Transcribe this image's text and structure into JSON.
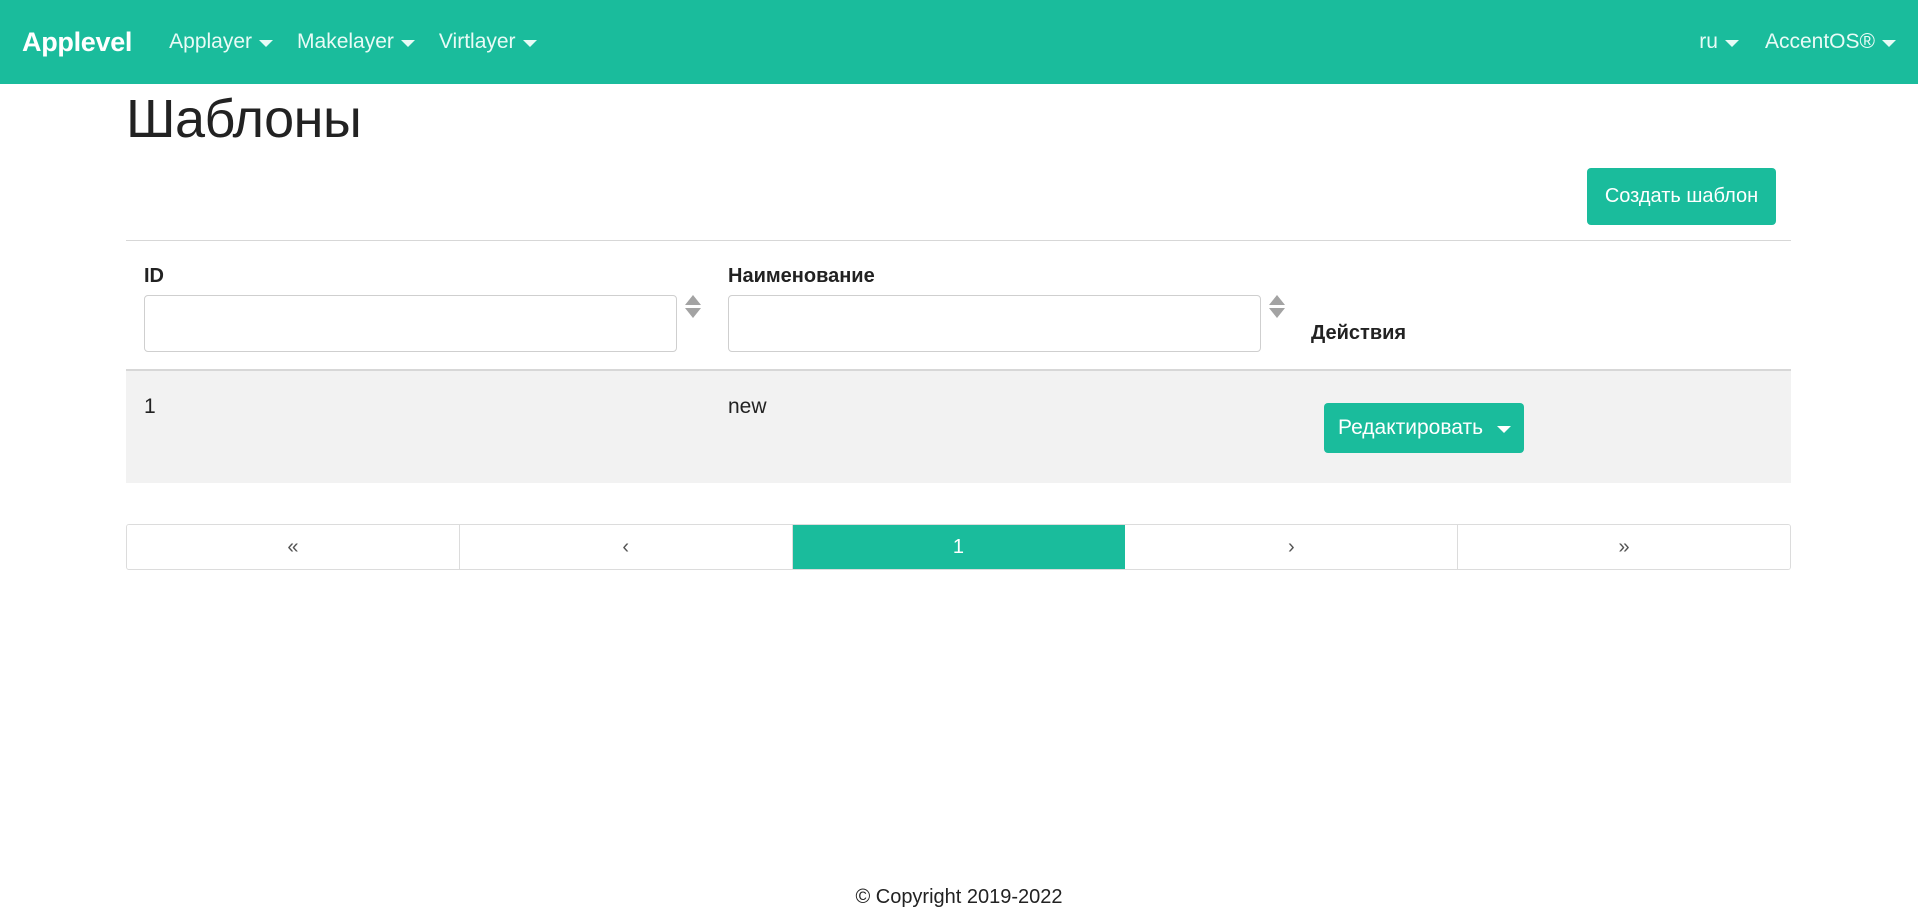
{
  "navbar": {
    "brand": "Applevel",
    "menus": [
      {
        "label": "Applayer"
      },
      {
        "label": "Makelayer"
      },
      {
        "label": "Virtlayer"
      }
    ],
    "right_menus": [
      {
        "label": "ru"
      },
      {
        "label": "AccentOS®"
      }
    ]
  },
  "page": {
    "title": "Шаблоны",
    "create_button": "Создать шаблон"
  },
  "table": {
    "columns": {
      "id": "ID",
      "name": "Наименование",
      "actions": "Действия"
    },
    "filters": {
      "id_value": "",
      "name_value": ""
    },
    "rows": [
      {
        "id": "1",
        "name": "new",
        "action": "Редактировать"
      }
    ]
  },
  "pagination": {
    "first": "«",
    "prev": "‹",
    "current": "1",
    "next": "›",
    "last": "»"
  },
  "footer": {
    "copyright": "© Copyright 2019-2022"
  },
  "colors": {
    "accent": "#1abc9c"
  }
}
